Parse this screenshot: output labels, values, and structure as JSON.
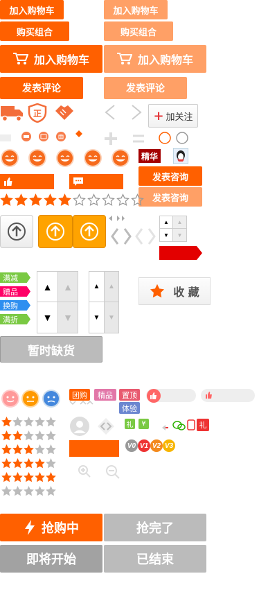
{
  "buttons": {
    "add_cart_small": "加入购物车",
    "add_cart_small_disabled": "加入购物车",
    "buy_combo": "购买组合",
    "buy_combo_disabled": "购买组合",
    "add_cart_large": "加入购物车",
    "add_cart_large_disabled": "加入购物车",
    "post_review": "发表评论",
    "post_review_disabled": "发表评论",
    "follow": "加关注",
    "consult": "发表咨询",
    "consult_disabled": "发表咨询",
    "sold_out": "暂时缺货",
    "favorite": "收 藏",
    "buying": "抢购中",
    "sold_all": "抢完了",
    "coming": "即将开始",
    "ended": "已结束"
  },
  "badges": {
    "essence": "精华"
  },
  "promo_tags": [
    "满减",
    "赠品",
    "换购",
    "满折"
  ],
  "labels": {
    "group_buy": "团购",
    "featured": "精品",
    "pinned": "置顶",
    "experience": "体验",
    "gift": "礼",
    "yen": "¥"
  },
  "vip_levels": [
    "V0",
    "V1",
    "V2",
    "V3"
  ],
  "ratings": [
    1,
    2,
    3,
    4,
    5,
    0
  ],
  "colors": {
    "primary": "#ff6000",
    "primary_light": "#ffa066",
    "gray": "#bbbbbb",
    "dark_gray": "#a2a2a2",
    "green": "#7ac943",
    "pink": "#f06",
    "blue": "#2e8ff0",
    "red": "#e30000"
  }
}
